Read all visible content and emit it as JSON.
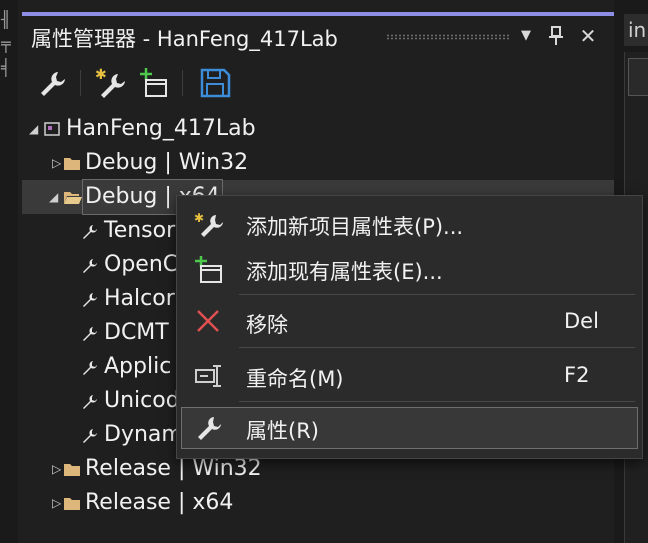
{
  "panel": {
    "title": "属性管理器 - HanFeng_417Lab",
    "buttons": [
      {
        "name": "dropdown-icon",
        "glyph": "▼"
      },
      {
        "name": "pin-icon",
        "glyph": "⊥"
      },
      {
        "name": "close-icon",
        "glyph": "✕"
      }
    ]
  },
  "toolbar": {
    "tools": [
      {
        "name": "properties-wrench-icon"
      },
      {
        "name": "add-new-property-sheet-icon"
      },
      {
        "name": "add-existing-property-sheet-icon"
      },
      {
        "name": "save-icon"
      }
    ]
  },
  "tree": {
    "project": "HanFeng_417Lab",
    "configs": [
      {
        "label": "Debug | Win32"
      },
      {
        "label": "Debug | x64"
      },
      {
        "label": "Release | Win32"
      },
      {
        "label": "Release | x64"
      }
    ],
    "sheets": [
      "Tensor",
      "OpenC",
      "Halcor",
      "DCMT",
      "Applic",
      "Unicod",
      "Dynam"
    ]
  },
  "context_menu": {
    "items": [
      {
        "label": "添加新项目属性表(P)...",
        "shortcut": "",
        "icon": "add-new-sheet-icon"
      },
      {
        "label": "添加现有属性表(E)...",
        "shortcut": "",
        "icon": "add-existing-sheet-icon"
      },
      {
        "label": "移除",
        "shortcut": "Del",
        "icon": "remove-x-icon"
      },
      {
        "label": "重命名(M)",
        "shortcut": "F2",
        "icon": "rename-icon"
      },
      {
        "label": "属性(R)",
        "shortcut": "",
        "icon": "properties-wrench-icon"
      }
    ]
  },
  "right_strip": {
    "tab_label": "in"
  },
  "colors": {
    "accent": "#8e8ee6",
    "save_blue": "#3c8cd9",
    "remove_red": "#e05050",
    "add_green": "#4ec94e",
    "star_gold": "#e8c040"
  }
}
